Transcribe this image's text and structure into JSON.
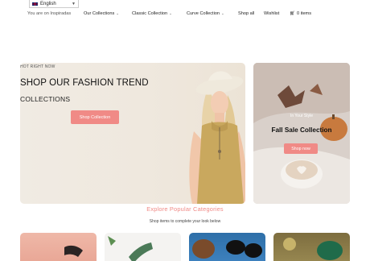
{
  "language": {
    "selected": "English",
    "flag_icon": "uk-flag-icon"
  },
  "nav": {
    "location_text": "You are on Inspiradas",
    "items": [
      {
        "label": "Our Collections",
        "has_dropdown": true
      },
      {
        "label": "Classic Collection",
        "has_dropdown": true
      },
      {
        "label": "Curve Collection",
        "has_dropdown": true
      },
      {
        "label": "Shop all",
        "has_dropdown": false
      },
      {
        "label": "Wishlist",
        "has_dropdown": false
      }
    ],
    "cart": {
      "icon": "cart-icon",
      "label": "0 items"
    }
  },
  "hero": {
    "eyebrow": "HOT RIGHT NOW",
    "title": "SHOP OUR FASHION TREND",
    "subtitle": "COLLECTIONS",
    "button_label": "Shop Collection"
  },
  "fall_banner": {
    "tag": "In Your Style",
    "title": "Fall Sale Collection",
    "button_label": "Shop now"
  },
  "categories": {
    "title": "Explore Popular Categories",
    "subtitle": "Shop items to complete your look below"
  },
  "colors": {
    "accent": "#f08a86",
    "hero_bg": "#f0ebe3"
  }
}
